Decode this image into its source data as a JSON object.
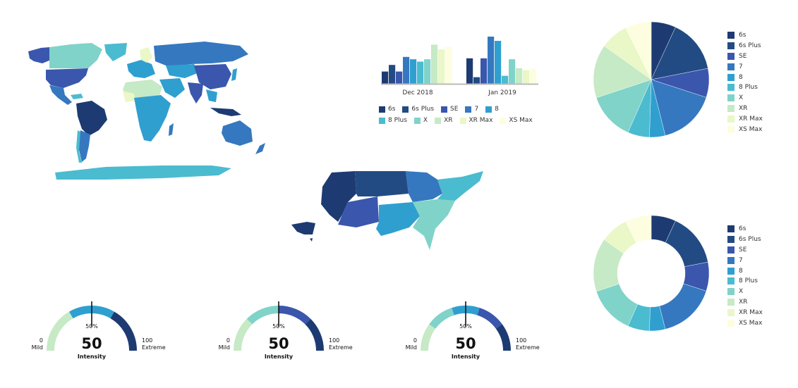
{
  "palette": {
    "6s": "#1d3b72",
    "6s Plus": "#234b83",
    "SE": "#3a56ad",
    "7": "#3578bf",
    "8": "#2f9fd0",
    "8 Plus": "#4bbbd0",
    "X": "#80d3c8",
    "XR": "#c6e9c6",
    "XR Max": "#eaf7c6",
    "XS Max": "#fdfde0"
  },
  "chart_data": [
    {
      "type": "bar",
      "title": "",
      "categories": [
        "Dec 2018",
        "Jan 2019"
      ],
      "series": [
        {
          "name": "6s",
          "values": [
            26,
            54
          ]
        },
        {
          "name": "6s Plus",
          "values": [
            40,
            14
          ]
        },
        {
          "name": "SE",
          "values": [
            26,
            54
          ]
        },
        {
          "name": "7",
          "values": [
            57,
            100
          ]
        },
        {
          "name": "8",
          "values": [
            52,
            91
          ]
        },
        {
          "name": "8 Plus",
          "values": [
            47,
            17
          ]
        },
        {
          "name": "X",
          "values": [
            52,
            52
          ]
        },
        {
          "name": "XR",
          "values": [
            83,
            33
          ]
        },
        {
          "name": "XR Max",
          "values": [
            73,
            29
          ]
        },
        {
          "name": "XS Max",
          "values": [
            78,
            32
          ]
        }
      ],
      "xlabel": "",
      "ylabel": "",
      "ylim": [
        0,
        100
      ],
      "grid": false,
      "legend_position": "bottom",
      "legend": [
        "6s",
        "6s Plus",
        "SE",
        "7",
        "8",
        "8 Plus",
        "X",
        "XR",
        "XR Max",
        "XS Max"
      ]
    },
    {
      "type": "pie",
      "title": "",
      "labels": [
        "6s",
        "6s Plus",
        "SE",
        "7",
        "8",
        "8 Plus",
        "X",
        "XR",
        "XR Max",
        "XS Max"
      ],
      "values": [
        6.9,
        15.0,
        8.1,
        16.1,
        4.4,
        6.1,
        13.3,
        15.0,
        7.8,
        7.3
      ],
      "legend_position": "right"
    },
    {
      "type": "pie",
      "variant": "donut",
      "title": "",
      "labels": [
        "6s",
        "6s Plus",
        "SE",
        "7",
        "8",
        "8 Plus",
        "X",
        "XR",
        "XR Max",
        "XS Max"
      ],
      "values": [
        6.9,
        15.0,
        8.1,
        16.1,
        4.4,
        6.1,
        13.3,
        15.0,
        7.8,
        7.3
      ],
      "legend_position": "right"
    },
    {
      "type": "gauge",
      "value": 50,
      "min_label": "0",
      "min_caption": "Mild",
      "max_label": "100",
      "max_caption": "Extreme",
      "percent_label": "50%",
      "value_label": "50",
      "caption": "Intensity",
      "bands": [
        "#c6e9c6",
        "#2f9fd0",
        "#1d3b72"
      ]
    },
    {
      "type": "gauge",
      "value": 50,
      "min_label": "0",
      "min_caption": "Mild",
      "max_label": "100",
      "max_caption": "Extreme",
      "percent_label": "50%",
      "value_label": "50",
      "caption": "Intensity",
      "bands": [
        "#c6e9c6",
        "#80d3c8",
        "#3a56ad",
        "#1d3b72"
      ]
    },
    {
      "type": "gauge",
      "value": 50,
      "min_label": "0",
      "min_caption": "Mild",
      "max_label": "100",
      "max_caption": "Extreme",
      "percent_label": "50%",
      "value_label": "50",
      "caption": "Intensity",
      "bands": [
        "#c6e9c6",
        "#80d3c8",
        "#2f9fd0",
        "#3a56ad",
        "#1d3b72"
      ]
    }
  ],
  "maps": {
    "world": {
      "name": "World choropleth map"
    },
    "usa": {
      "name": "US states choropleth map"
    }
  }
}
